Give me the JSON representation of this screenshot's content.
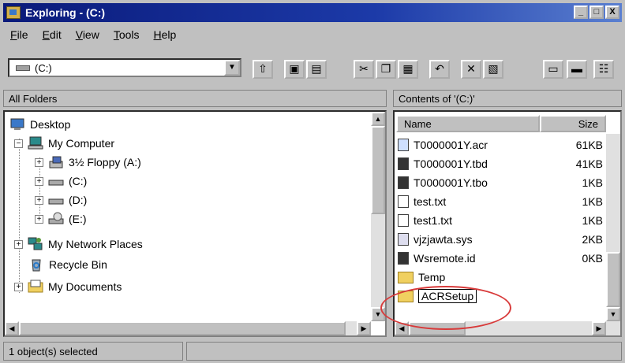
{
  "window": {
    "title": "Exploring - (C:)",
    "controls": [
      "_",
      "□",
      "X"
    ]
  },
  "menu": {
    "items": [
      {
        "first": "F",
        "rest": "ile"
      },
      {
        "first": "E",
        "rest": "dit"
      },
      {
        "first": "V",
        "rest": "iew"
      },
      {
        "first": "T",
        "rest": "ools"
      },
      {
        "first": "H",
        "rest": "elp"
      }
    ]
  },
  "toolbar": {
    "address_value": "(C:)",
    "buttons": [
      {
        "name": "up-one-level",
        "glyph": "⇧"
      },
      {
        "name": "map-network-drive",
        "glyph": "▣"
      },
      {
        "name": "disconnect-network-drive",
        "glyph": "▤"
      },
      {
        "name": "cut",
        "glyph": "✂"
      },
      {
        "name": "copy",
        "glyph": "❐"
      },
      {
        "name": "paste",
        "glyph": "▦"
      },
      {
        "name": "undo",
        "glyph": "↶"
      },
      {
        "name": "delete",
        "glyph": "✕"
      },
      {
        "name": "properties",
        "glyph": "▧"
      },
      {
        "name": "large-icons",
        "glyph": "▭"
      },
      {
        "name": "small-icons",
        "glyph": "▬"
      },
      {
        "name": "list-view",
        "glyph": "☷"
      }
    ]
  },
  "left_pane": {
    "header": "All Folders",
    "tree": [
      {
        "label": "Desktop",
        "icon": "desktop-icon",
        "expander": ""
      },
      {
        "label": "My Computer",
        "icon": "computer-icon",
        "expander": "−"
      },
      {
        "label": "3½ Floppy (A:)",
        "icon": "floppy-icon",
        "expander": "+"
      },
      {
        "label": "(C:)",
        "icon": "drive-icon",
        "expander": "+"
      },
      {
        "label": "(D:)",
        "icon": "drive-icon",
        "expander": "+"
      },
      {
        "label": "(E:)",
        "icon": "cdrom-icon",
        "expander": "+"
      },
      {
        "label": "My Network Places",
        "icon": "network-icon",
        "expander": "+"
      },
      {
        "label": "Recycle Bin",
        "icon": "recycle-bin-icon",
        "expander": ""
      },
      {
        "label": "My Documents",
        "icon": "documents-icon",
        "expander": "+"
      }
    ]
  },
  "right_pane": {
    "header": "Contents of '(C:)'",
    "columns": {
      "name": "Name",
      "size": "Size"
    },
    "files": [
      {
        "name": "T0000001Y.acr",
        "size": "61KB",
        "icon": "acr-file-icon"
      },
      {
        "name": "T0000001Y.tbd",
        "size": "41KB",
        "icon": "image-file-icon"
      },
      {
        "name": "T0000001Y.tbo",
        "size": "1KB",
        "icon": "image-file-icon"
      },
      {
        "name": "test.txt",
        "size": "1KB",
        "icon": "text-file-icon"
      },
      {
        "name": "test1.txt",
        "size": "1KB",
        "icon": "text-file-icon"
      },
      {
        "name": "vjzjawta.sys",
        "size": "2KB",
        "icon": "system-file-icon"
      },
      {
        "name": "Wsremote.id",
        "size": "0KB",
        "icon": "image-file-icon"
      },
      {
        "name": "Temp",
        "size": "",
        "icon": "folder-icon"
      },
      {
        "name": "ACRSetup",
        "size": "",
        "icon": "folder-icon",
        "renaming": true
      }
    ]
  },
  "status": {
    "text": "1 object(s) selected"
  },
  "annotation_color": "#d83a3a"
}
